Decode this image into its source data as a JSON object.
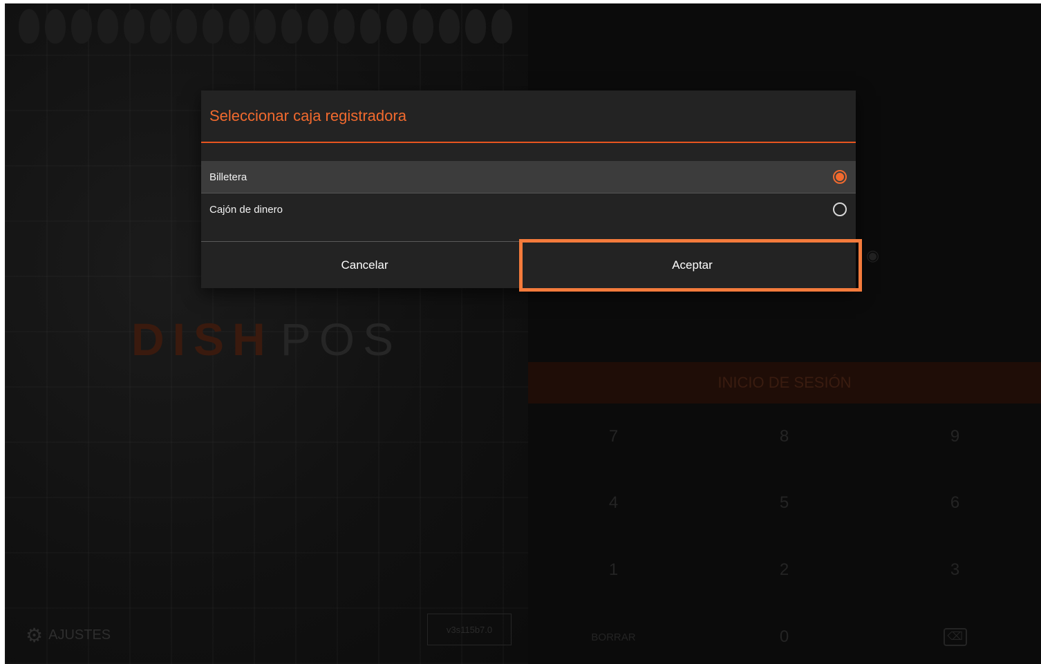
{
  "dialog": {
    "title": "Seleccionar caja registradora",
    "options": [
      {
        "label": "Billetera",
        "selected": true
      },
      {
        "label": "Cajón de dinero",
        "selected": false
      }
    ],
    "cancel_label": "Cancelar",
    "accept_label": "Aceptar"
  },
  "background": {
    "brand_dish": "DISH",
    "brand_pos": "POS",
    "settings_label": "AJUSTES",
    "version": "v3s115b7.0",
    "login_label": "INICIO DE SESIÓN",
    "keypad": [
      "7",
      "8",
      "9",
      "4",
      "5",
      "6",
      "1",
      "2",
      "3",
      "BORRAR",
      "0",
      "⌫"
    ]
  },
  "colors": {
    "accent": "#f26a2e",
    "highlight": "#f47b3c",
    "dialog_bg": "#232323",
    "selected_row": "#3c3c3c"
  }
}
